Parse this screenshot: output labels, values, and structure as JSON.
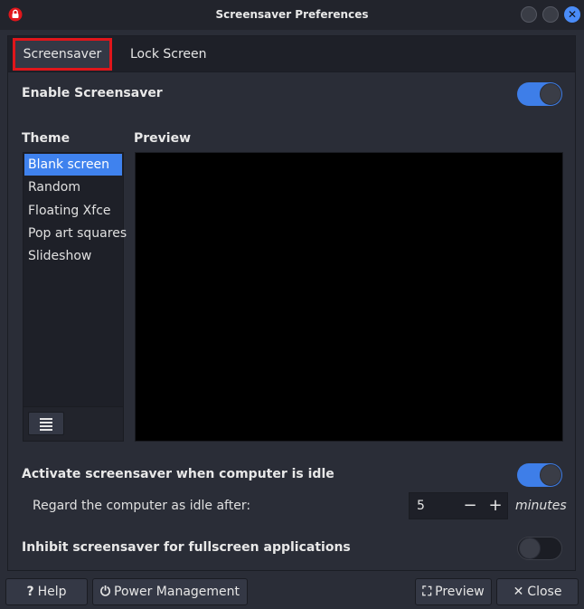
{
  "window": {
    "title": "Screensaver Preferences",
    "lock_icon": "lock-icon",
    "close_glyph": "✕"
  },
  "tabs": [
    {
      "label": "Screensaver",
      "active": true
    },
    {
      "label": "Lock Screen",
      "active": false
    }
  ],
  "screensaver": {
    "enable_label": "Enable Screensaver",
    "enable_on": true,
    "theme_heading": "Theme",
    "preview_heading": "Preview",
    "themes": [
      "Blank screen",
      "Random",
      "Floating Xfce",
      "Pop art squares",
      "Slideshow"
    ],
    "selected_theme": "Blank screen",
    "list_menu_glyph": "≣",
    "idle_activate_label": "Activate screensaver when computer is idle",
    "idle_activate_on": true,
    "idle_after_label": "Regard the computer as idle after:",
    "idle_minutes": "5",
    "minus_glyph": "−",
    "plus_glyph": "+",
    "minutes_label": "minutes",
    "inhibit_label": "Inhibit screensaver for fullscreen applications",
    "inhibit_on": false
  },
  "buttons": {
    "help": {
      "label": "Help",
      "icon": "?"
    },
    "power": {
      "label": "Power Management",
      "icon": "⏻"
    },
    "preview": {
      "label": "Preview",
      "icon": "⛶"
    },
    "close": {
      "label": "Close",
      "icon": "✕"
    }
  },
  "colors": {
    "accent": "#3f82ee",
    "highlight_outline": "#e0161b"
  }
}
